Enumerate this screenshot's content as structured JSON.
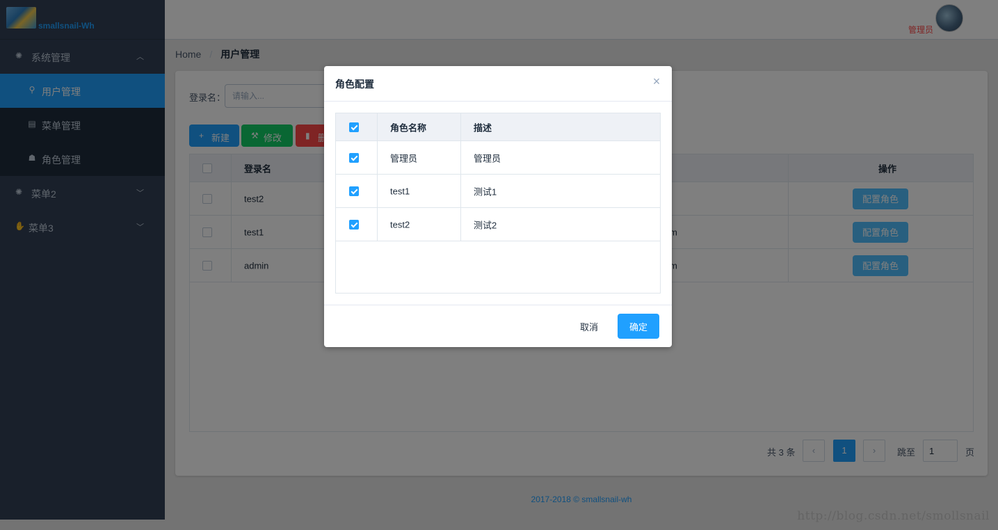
{
  "app": {
    "logo_text": "smallsnail-Wh",
    "user_name": "管理员"
  },
  "sidebar": {
    "groups": [
      {
        "label": "系统管理",
        "arrow": "⌃",
        "items": [
          {
            "label": "用户管理"
          },
          {
            "label": "菜单管理"
          },
          {
            "label": "角色管理"
          }
        ]
      },
      {
        "label": "菜单2",
        "arrow": "⌄"
      },
      {
        "label": "菜单3",
        "arrow": "⌄"
      }
    ]
  },
  "breadcrumb": {
    "home": "Home",
    "sep": "/",
    "current": "用户管理"
  },
  "search": {
    "label": "登录名：",
    "placeholder": "请输入..."
  },
  "toolbar": {
    "new_label": "新建",
    "edit_label": "修改",
    "delete_label": "删除"
  },
  "table": {
    "headers": {
      "login": "登录名",
      "op": "操作"
    },
    "rows": [
      {
        "login": "test2",
        "email": "",
        "action": "配置角色"
      },
      {
        "login": "test1",
        "email": "m",
        "action": "配置角色"
      },
      {
        "login": "admin",
        "email": "m",
        "action": "配置角色"
      }
    ]
  },
  "pagination": {
    "total": "共 3 条",
    "prev": "‹",
    "current": "1",
    "next": "›",
    "jump_label": "跳至",
    "jump_value": "1",
    "page_label": "页"
  },
  "footer": {
    "text": "2017-2018 © smallsnail-wh"
  },
  "watermark": "http://blog.csdn.net/smollsnail",
  "dialog": {
    "title": "角色配置",
    "close": "×",
    "headers": {
      "name": "角色名称",
      "desc": "描述"
    },
    "rows": [
      {
        "name": "管理员",
        "desc": "管理员",
        "checked": true
      },
      {
        "name": "test1",
        "desc": "测试1",
        "checked": true
      },
      {
        "name": "test2",
        "desc": "测试2",
        "checked": true
      }
    ],
    "cancel_label": "取消",
    "ok_label": "确定"
  },
  "colors": {
    "primary": "#20a0ff",
    "success": "#13ce66",
    "danger": "#ff4949",
    "info": "#50bfff",
    "sidebar": "#324157"
  }
}
